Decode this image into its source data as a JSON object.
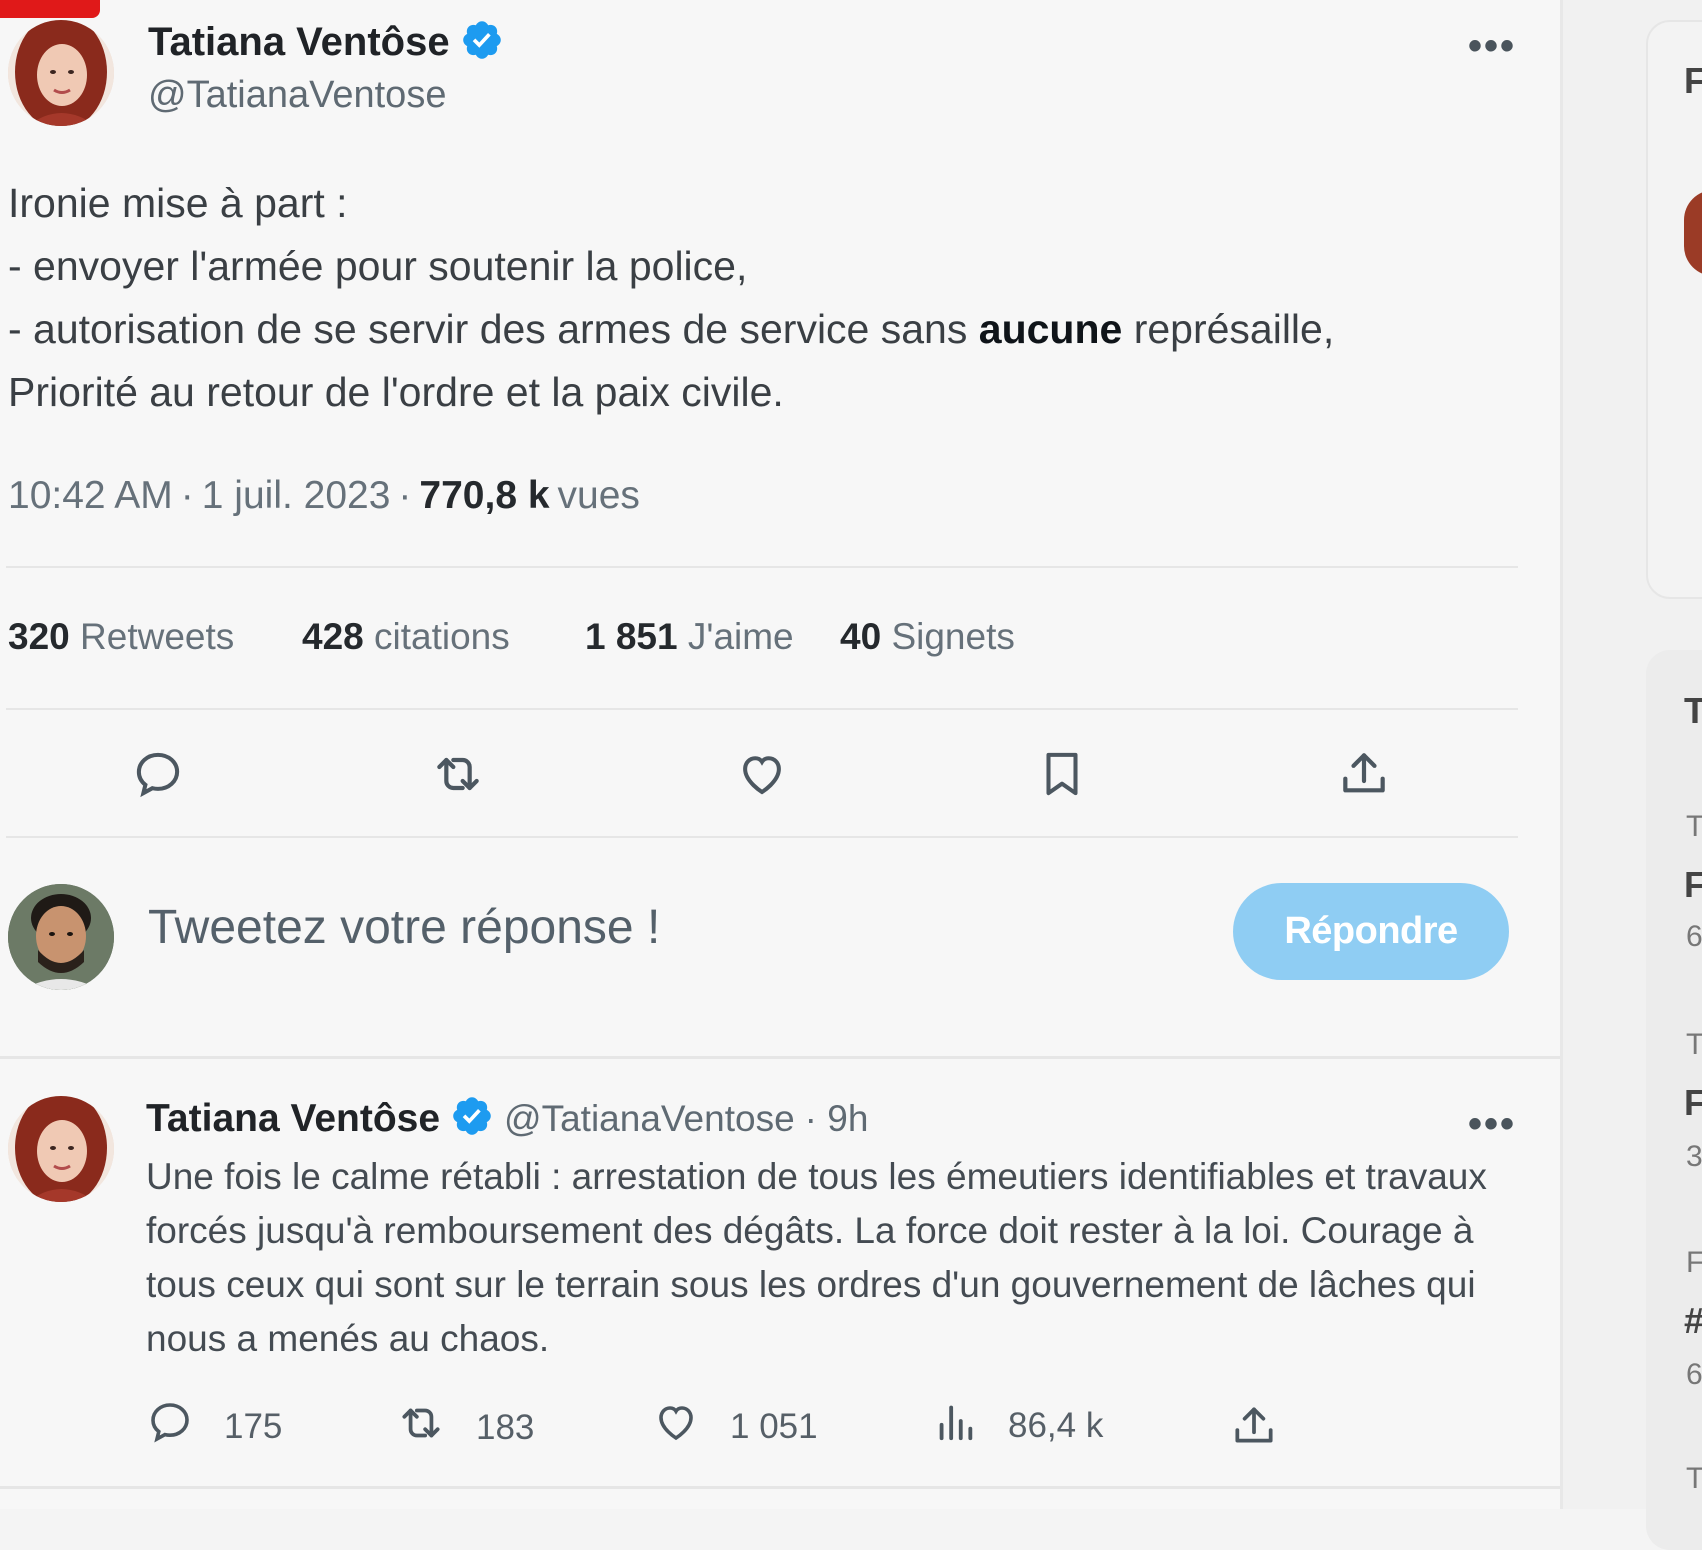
{
  "tweet": {
    "author_name": "Tatiana Ventôse",
    "author_handle": "@TatianaVentose",
    "more_label": "•••",
    "lines": [
      "Ironie mise à part :",
      "- envoyer l'armée pour soutenir la police,",
      "- autorisation de se servir des armes de service sans",
      "aucune",
      " représaille,",
      "Priorité au retour de l'ordre et la paix civile."
    ],
    "time": "10:42 AM",
    "date": "1 juil. 2023",
    "views_count": "770,8 k",
    "views_label": "vues",
    "sep": "·"
  },
  "stats": [
    {
      "count": "320",
      "label": "Retweets"
    },
    {
      "count": "428",
      "label": "citations"
    },
    {
      "count": "1 851",
      "label": "J'aime"
    },
    {
      "count": "40",
      "label": "Signets"
    }
  ],
  "compose": {
    "placeholder": "Tweetez votre réponse !",
    "reply_button": "Répondre"
  },
  "reply": {
    "author_name": "Tatiana Ventôse",
    "author_handle": "@TatianaVentose",
    "age": "· 9h",
    "more_label": "•••",
    "text": "Une fois le calme rétabli : arrestation de tous les émeutiers identifiables et travaux forcés jusqu'à remboursement des dégâts. La force doit rester à la loi. Courage à tous ceux qui sont sur le terrain sous les ordres d'un gouvernement de lâches qui nous a menés au chaos.",
    "replies": "175",
    "retweets": "183",
    "likes": "1 051",
    "views": "86,4 k"
  },
  "right_panel": {
    "letters": [
      "F",
      "T",
      "T",
      "F",
      "T",
      "F",
      "F",
      "#",
      "T"
    ],
    "smalls": [
      "6",
      "3",
      "6"
    ]
  },
  "colors": {
    "verified": "#1d9bf0",
    "reply_button": "#8fcdf3",
    "badge": "#e01919"
  }
}
